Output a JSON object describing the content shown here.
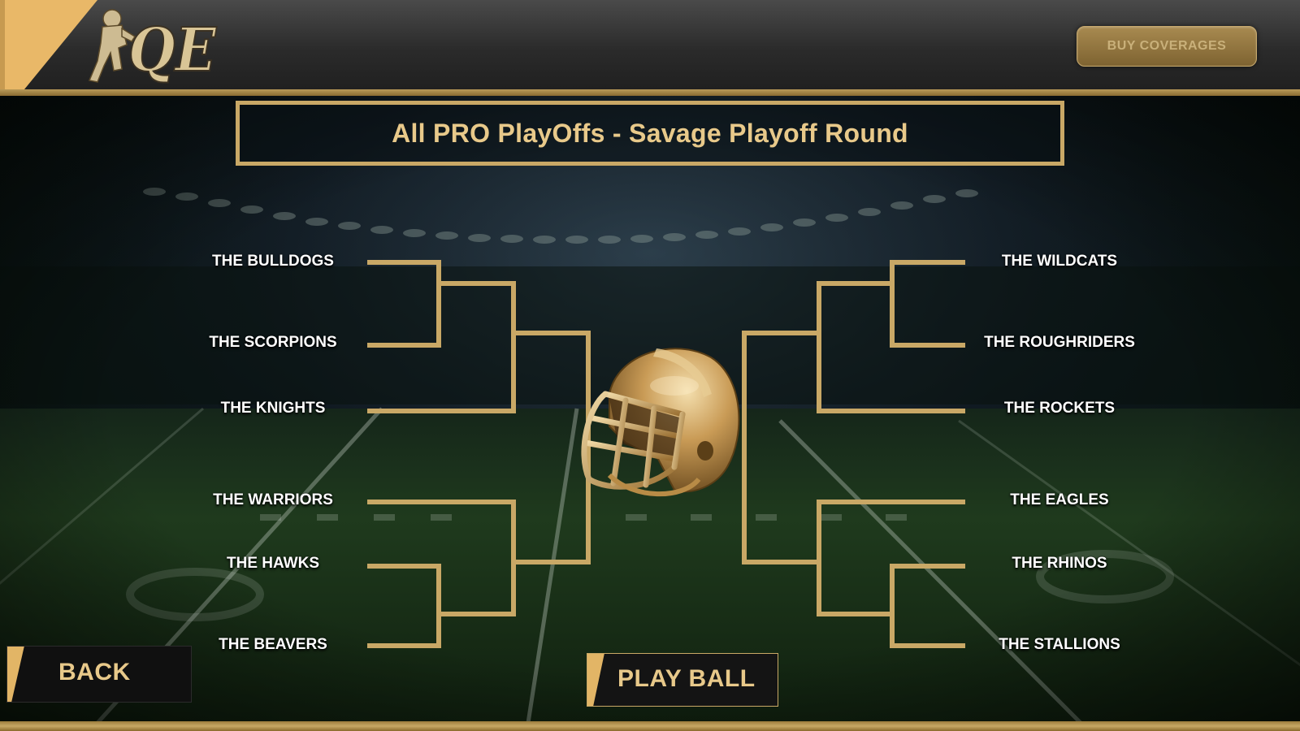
{
  "header": {
    "logo_text": "QE",
    "buy_button_label": "BUY COVERAGES"
  },
  "title": "All PRO PlayOffs - Savage Playoff Round",
  "bracket": {
    "left_top": [
      "THE BULLDOGS",
      "THE SCORPIONS",
      "THE KNIGHTS"
    ],
    "left_bottom": [
      "THE WARRIORS",
      "THE HAWKS",
      "THE BEAVERS"
    ],
    "right_top": [
      "THE WILDCATS",
      "THE ROUGHRIDERS",
      "THE ROCKETS"
    ],
    "right_bottom": [
      "THE EAGLES",
      "THE RHINOS",
      "THE STALLIONS"
    ],
    "center_icon": "football-helmet-icon"
  },
  "buttons": {
    "back": "BACK",
    "play": "PLAY BALL"
  },
  "colors": {
    "gold": "#c9a866",
    "title_text": "#e8c98a",
    "team_text": "#ffffff",
    "field_green": "#1d3a1c"
  }
}
